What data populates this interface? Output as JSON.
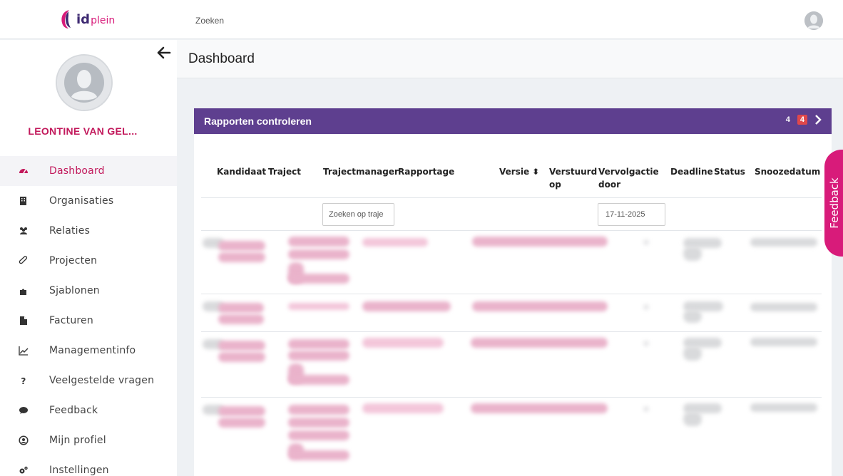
{
  "brand": {
    "logo_id": "id",
    "logo_plein": "plein",
    "primary_color": "#5e3f8f",
    "accent_color": "#c2185b",
    "badge_color": "#e0484b",
    "feedback_color": "#d81b7a"
  },
  "topbar": {
    "search_label": "Zoeken"
  },
  "sidebar": {
    "user_name": "LEONTINE VAN GEL...",
    "items": [
      {
        "label": "Dashboard",
        "icon": "tachometer-icon",
        "active": true
      },
      {
        "label": "Organisaties",
        "icon": "building-icon",
        "active": false
      },
      {
        "label": "Relaties",
        "icon": "users-icon",
        "active": false
      },
      {
        "label": "Projecten",
        "icon": "paperclip-icon",
        "active": false
      },
      {
        "label": "Sjablonen",
        "icon": "puzzle-icon",
        "active": false
      },
      {
        "label": "Facturen",
        "icon": "file-icon",
        "active": false
      },
      {
        "label": "Managementinfo",
        "icon": "line-chart-icon",
        "active": false
      },
      {
        "label": "Veelgestelde vragen",
        "icon": "question-icon",
        "active": false
      },
      {
        "label": "Feedback",
        "icon": "comment-icon",
        "active": false
      },
      {
        "label": "Mijn profiel",
        "icon": "user-circle-icon",
        "active": false
      },
      {
        "label": "Instellingen",
        "icon": "cogs-icon",
        "active": false
      }
    ]
  },
  "page": {
    "title": "Dashboard"
  },
  "card": {
    "title": "Rapporten controleren",
    "count": "4",
    "badge": "4",
    "columns": [
      {
        "line1": "Kandidaat",
        "line2": ""
      },
      {
        "line1": "Traject",
        "line2": ""
      },
      {
        "line1": "Trajectmanager",
        "line2": ""
      },
      {
        "line1": "Rapportage",
        "line2": ""
      },
      {
        "line1": "Versie ⬍",
        "line2": ""
      },
      {
        "line1": "Verstuurd",
        "line2": "op"
      },
      {
        "line1": "Vervolgactie",
        "line2": "door"
      },
      {
        "line1": "Deadline",
        "line2": ""
      },
      {
        "line1": "Status",
        "line2": ""
      },
      {
        "line1": "Snoozedatum",
        "line2": ""
      }
    ],
    "filter_traject_value": "Zoeken op traje",
    "filter_date_value": "17-11-2025"
  },
  "feedback_tab": {
    "label": "Feedback"
  }
}
